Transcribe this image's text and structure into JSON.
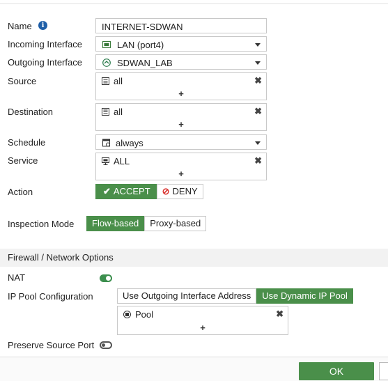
{
  "form": {
    "name_label": "Name",
    "name_value": "INTERNET-SDWAN",
    "incoming_label": "Incoming Interface",
    "incoming_value": "LAN (port4)",
    "outgoing_label": "Outgoing Interface",
    "outgoing_value": "SDWAN_LAB",
    "source_label": "Source",
    "source_value": "all",
    "destination_label": "Destination",
    "destination_value": "all",
    "schedule_label": "Schedule",
    "schedule_value": "always",
    "service_label": "Service",
    "service_value": "ALL",
    "action_label": "Action",
    "action_accept": "ACCEPT",
    "action_deny": "DENY",
    "action_selected": "ACCEPT",
    "inspection_label": "Inspection Mode",
    "inspection_flow": "Flow-based",
    "inspection_proxy": "Proxy-based",
    "inspection_selected": "Flow-based",
    "add_symbol": "+",
    "remove_symbol": "✖"
  },
  "firewall_options": {
    "section_title": "Firewall / Network Options",
    "nat_label": "NAT",
    "nat_enabled": true,
    "ip_pool_label": "IP Pool Configuration",
    "ip_pool_outgoing": "Use Outgoing Interface Address",
    "ip_pool_dynamic": "Use Dynamic IP Pool",
    "ip_pool_selected": "Use Dynamic IP Pool",
    "pool_value": "Pool",
    "preserve_port_label": "Preserve Source Port",
    "preserve_port_enabled": false
  },
  "footer": {
    "ok_label": "OK"
  },
  "icons": {
    "info": "info-icon",
    "interface": "network-port-icon",
    "sdwan": "sdwan-icon",
    "address": "address-icon",
    "schedule": "schedule-icon",
    "service": "service-icon",
    "accept": "check-icon",
    "deny": "deny-icon",
    "pool": "ip-pool-icon"
  },
  "colors": {
    "accent_green": "#4a8f4a",
    "deny_red": "#d9302c",
    "info_blue": "#1f5fa8"
  }
}
